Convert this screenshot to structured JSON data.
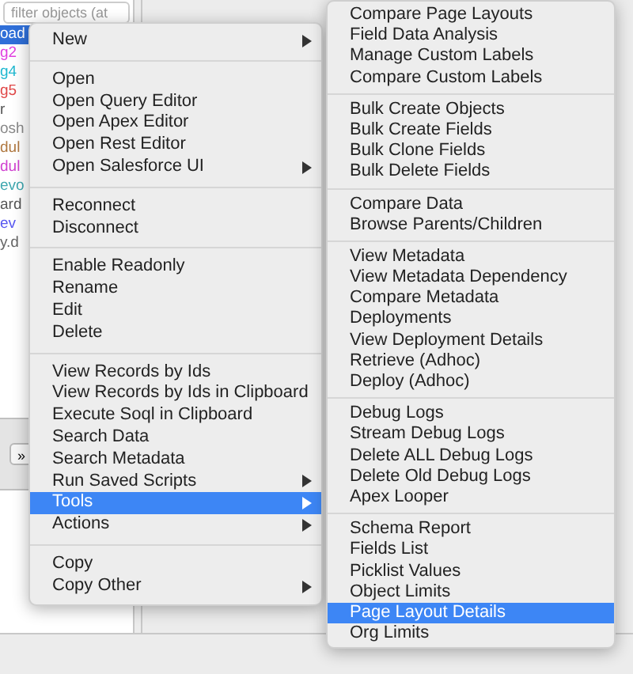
{
  "sidebar": {
    "search": {
      "placeholder": "filter objects (at"
    },
    "rows": [
      {
        "label": "oad",
        "selected": true,
        "color": "#ffffff"
      },
      {
        "label": "g2",
        "selected": false,
        "color": "#e040e0"
      },
      {
        "label": "g4",
        "selected": false,
        "color": "#20b8d0"
      },
      {
        "label": "g5",
        "selected": false,
        "color": "#e04848"
      },
      {
        "label": "r",
        "selected": false,
        "color": "#555555"
      },
      {
        "label": "osh",
        "selected": false,
        "color": "#8a8a8a"
      },
      {
        "label": "dul",
        "selected": false,
        "color": "#b07840"
      },
      {
        "label": "dul",
        "selected": false,
        "color": "#d040d0"
      },
      {
        "label": "evo",
        "selected": false,
        "color": "#40a8b0"
      },
      {
        "label": "ard",
        "selected": false,
        "color": "#555555"
      },
      {
        "label": "ev",
        "selected": false,
        "color": "#5858f0"
      },
      {
        "label": "y.d",
        "selected": false,
        "color": "#666666"
      }
    ],
    "toolbar_button": "»"
  },
  "context_menu": {
    "groups": [
      [
        {
          "label": "New",
          "submenu": true,
          "selected": false
        }
      ],
      [
        {
          "label": "Open",
          "submenu": false,
          "selected": false
        },
        {
          "label": "Open Query Editor",
          "submenu": false,
          "selected": false
        },
        {
          "label": "Open Apex Editor",
          "submenu": false,
          "selected": false
        },
        {
          "label": "Open Rest Editor",
          "submenu": false,
          "selected": false
        },
        {
          "label": "Open Salesforce UI",
          "submenu": true,
          "selected": false
        }
      ],
      [
        {
          "label": "Reconnect",
          "submenu": false,
          "selected": false
        },
        {
          "label": "Disconnect",
          "submenu": false,
          "selected": false
        }
      ],
      [
        {
          "label": "Enable Readonly",
          "submenu": false,
          "selected": false
        },
        {
          "label": "Rename",
          "submenu": false,
          "selected": false
        },
        {
          "label": "Edit",
          "submenu": false,
          "selected": false
        },
        {
          "label": "Delete",
          "submenu": false,
          "selected": false
        }
      ],
      [
        {
          "label": "View Records by Ids",
          "submenu": false,
          "selected": false
        },
        {
          "label": "View Records by Ids in Clipboard",
          "submenu": false,
          "selected": false
        },
        {
          "label": "Execute Soql in Clipboard",
          "submenu": false,
          "selected": false
        },
        {
          "label": "Search Data",
          "submenu": false,
          "selected": false
        },
        {
          "label": "Search Metadata",
          "submenu": false,
          "selected": false
        },
        {
          "label": "Run Saved Scripts",
          "submenu": true,
          "selected": false
        },
        {
          "label": "Tools",
          "submenu": true,
          "selected": true
        },
        {
          "label": "Actions",
          "submenu": true,
          "selected": false
        }
      ],
      [
        {
          "label": "Copy",
          "submenu": false,
          "selected": false
        },
        {
          "label": "Copy Other",
          "submenu": true,
          "selected": false
        }
      ]
    ]
  },
  "tools_submenu": {
    "groups": [
      [
        {
          "label": "Compare Page Layouts",
          "selected": false
        },
        {
          "label": "Field Data Analysis",
          "selected": false
        },
        {
          "label": "Manage Custom Labels",
          "selected": false
        },
        {
          "label": "Compare Custom Labels",
          "selected": false
        }
      ],
      [
        {
          "label": "Bulk Create Objects",
          "selected": false
        },
        {
          "label": "Bulk Create Fields",
          "selected": false
        },
        {
          "label": "Bulk Clone Fields",
          "selected": false
        },
        {
          "label": "Bulk Delete Fields",
          "selected": false
        }
      ],
      [
        {
          "label": "Compare Data",
          "selected": false
        },
        {
          "label": "Browse Parents/Children",
          "selected": false
        }
      ],
      [
        {
          "label": "View Metadata",
          "selected": false
        },
        {
          "label": "View Metadata Dependency",
          "selected": false
        },
        {
          "label": "Compare Metadata",
          "selected": false
        },
        {
          "label": "Deployments",
          "selected": false
        },
        {
          "label": "View Deployment Details",
          "selected": false
        },
        {
          "label": "Retrieve (Adhoc)",
          "selected": false
        },
        {
          "label": "Deploy (Adhoc)",
          "selected": false
        }
      ],
      [
        {
          "label": "Debug Logs",
          "selected": false
        },
        {
          "label": "Stream Debug Logs",
          "selected": false
        },
        {
          "label": "Delete ALL Debug Logs",
          "selected": false
        },
        {
          "label": "Delete Old Debug Logs",
          "selected": false
        },
        {
          "label": "Apex Looper",
          "selected": false
        }
      ],
      [
        {
          "label": "Schema Report",
          "selected": false
        },
        {
          "label": "Fields List",
          "selected": false
        },
        {
          "label": "Picklist Values",
          "selected": false
        },
        {
          "label": "Object Limits",
          "selected": false
        },
        {
          "label": "Page Layout Details",
          "selected": true
        },
        {
          "label": "Org Limits",
          "selected": false
        }
      ]
    ]
  }
}
